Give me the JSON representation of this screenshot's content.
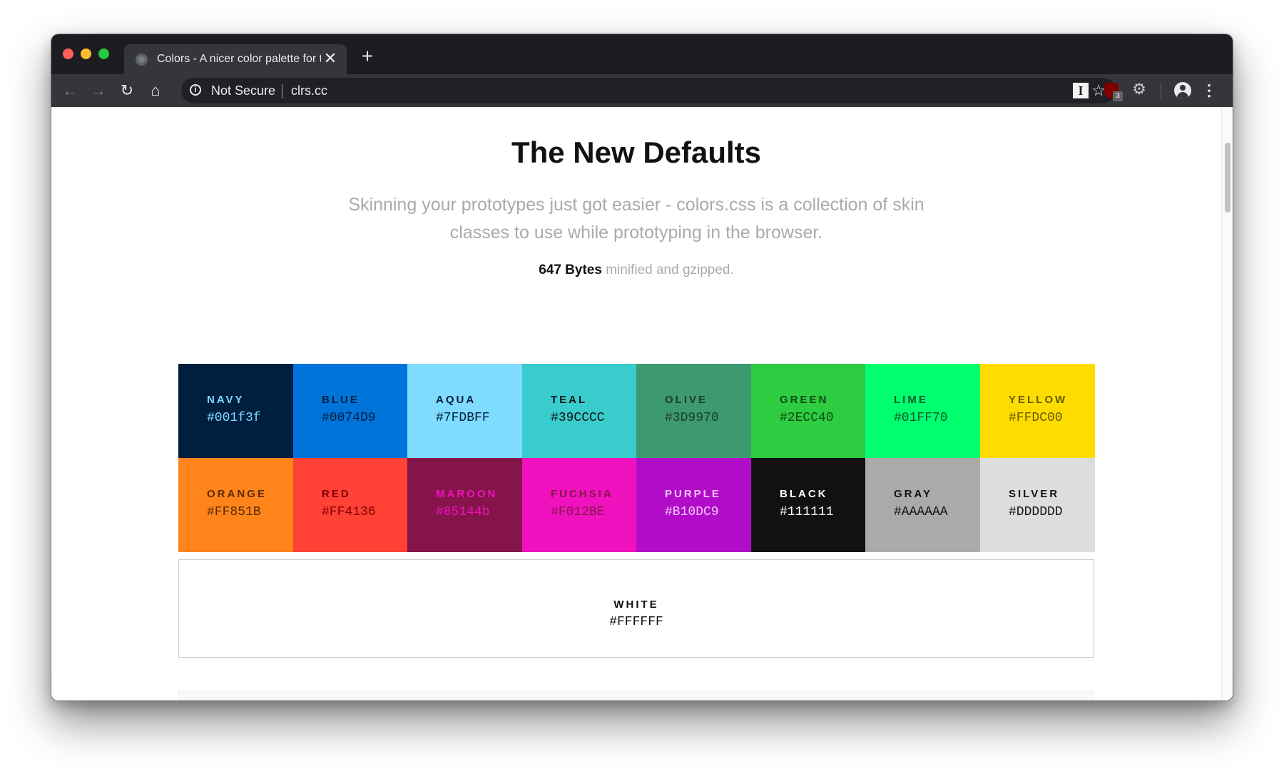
{
  "browser": {
    "tab": {
      "title": "Colors - A nicer color palette for the web",
      "close": "✕"
    },
    "new_tab": "+",
    "nav": {
      "back": "←",
      "forward": "→",
      "reload": "↻",
      "home": "⌂"
    },
    "omnibox": {
      "info": "i",
      "security": "Not Secure",
      "url": "clrs.cc",
      "bookmark": "☆"
    },
    "extensions": {
      "instapaper": "I",
      "ublock_badge": "3",
      "settings": "⚙",
      "menu": "⋮"
    }
  },
  "page": {
    "title": "The New Defaults",
    "lead": "Skinning your prototypes just got easier - colors.css is a collection of skin classes to use while prototyping in the browser.",
    "size_strong": "647 Bytes",
    "size_rest": " minified and gzipped."
  },
  "swatches": [
    {
      "name": "NAVY",
      "hex": "#001f3f",
      "bg": "#001f3f",
      "text": "#7FDBFF"
    },
    {
      "name": "BLUE",
      "hex": "#0074D9",
      "bg": "#0074D9",
      "text": "#001f3f"
    },
    {
      "name": "AQUA",
      "hex": "#7FDBFF",
      "bg": "#7FDBFF",
      "text": "#001f3f"
    },
    {
      "name": "TEAL",
      "hex": "#39CCCC",
      "bg": "#39CCCC",
      "text": "#111111"
    },
    {
      "name": "OLIVE",
      "hex": "#3D9970",
      "bg": "#3D9970",
      "text": "#1a3d2e"
    },
    {
      "name": "GREEN",
      "hex": "#2ECC40",
      "bg": "#2ECC40",
      "text": "#0d4a16"
    },
    {
      "name": "LIME",
      "hex": "#01FF70",
      "bg": "#01FF70",
      "text": "#0a5a2c"
    },
    {
      "name": "YELLOW",
      "hex": "#FFDC00",
      "bg": "#FFDC00",
      "text": "#665800"
    },
    {
      "name": "ORANGE",
      "hex": "#FF851B",
      "bg": "#FF851B",
      "text": "#5c2a00"
    },
    {
      "name": "RED",
      "hex": "#FF4136",
      "bg": "#FF4136",
      "text": "#800000"
    },
    {
      "name": "MAROON",
      "hex": "#85144b",
      "bg": "#85144b",
      "text": "#F012BE"
    },
    {
      "name": "FUCHSIA",
      "hex": "#F012BE",
      "bg": "#F012BE",
      "text": "#85144b"
    },
    {
      "name": "PURPLE",
      "hex": "#B10DC9",
      "bg": "#B10DC9",
      "text": "#f5c6fb"
    },
    {
      "name": "BLACK",
      "hex": "#111111",
      "bg": "#111111",
      "text": "#ffffff"
    },
    {
      "name": "GRAY",
      "hex": "#AAAAAA",
      "bg": "#AAAAAA",
      "text": "#111111"
    },
    {
      "name": "SILVER",
      "hex": "#DDDDDD",
      "bg": "#DDDDDD",
      "text": "#111111"
    }
  ],
  "white": {
    "name": "WHITE",
    "hex": "#FFFFFF"
  }
}
